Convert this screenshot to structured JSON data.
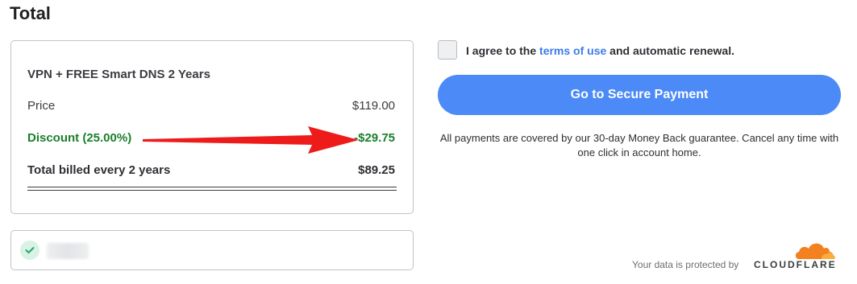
{
  "heading": "Total",
  "summary": {
    "plan_name": "VPN + FREE Smart DNS 2 Years",
    "price_label": "Price",
    "price_value": "$119.00",
    "discount_label": "Discount (25.00%)",
    "discount_value": "-$29.75",
    "total_label": "Total billed every 2 years",
    "total_value": "$89.25"
  },
  "coupon": {
    "icon": "check-icon"
  },
  "agreement": {
    "prefix": "I agree to the ",
    "link": "terms of use",
    "suffix": " and automatic renewal."
  },
  "payment": {
    "button_label": "Go to Secure Payment",
    "guarantee": "All payments are covered by our 30-day Money Back guarantee. Cancel any time with one click in account home."
  },
  "footer": {
    "protected_label": "Your data is protected by",
    "brand": "CLOUDFLARE"
  },
  "colors": {
    "accent": "#4b8af7",
    "discount_green": "#1a7f2b",
    "annotation_red": "#ee1b1b",
    "cloudflare_orange": "#f48120"
  }
}
